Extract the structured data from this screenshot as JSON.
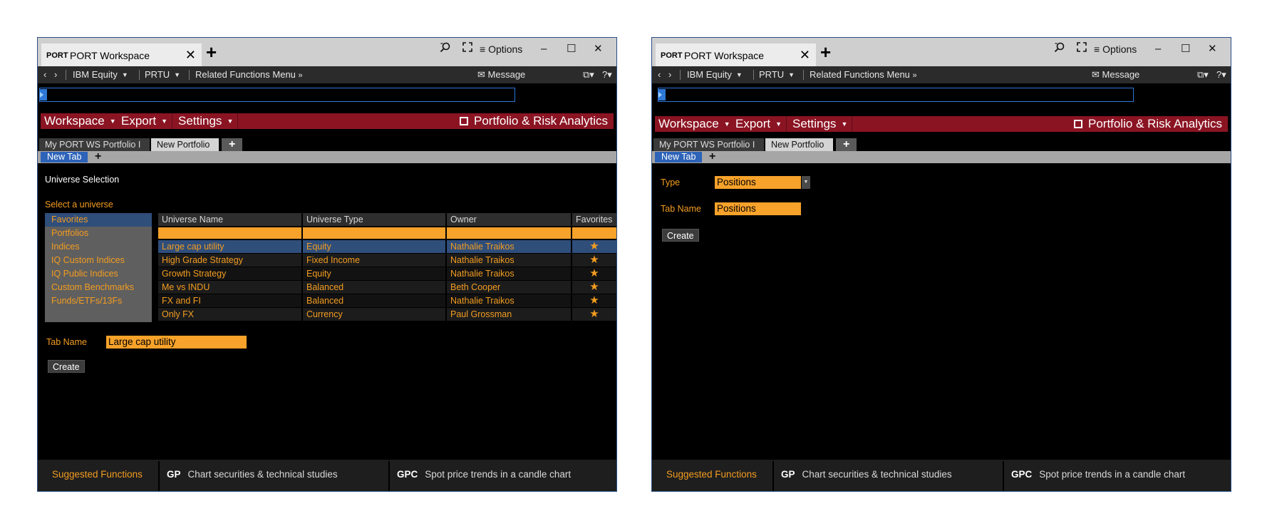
{
  "windows": [
    {
      "tab_prefix": "PORT",
      "tab_title": "PORT Workspace",
      "options_label": "Options",
      "nav": {
        "security": "IBM Equity",
        "function": "PRTU",
        "related": "Related Functions Menu",
        "message": "Message"
      },
      "menus": [
        "Workspace",
        "Export",
        "Settings"
      ],
      "app_title": "Portfolio & Risk Analytics",
      "portfolio_tabs": [
        "My PORT WS Portfolio I",
        "New Portfolio"
      ],
      "inner_tab": "New Tab",
      "heading": "Universe Selection",
      "select_label": "Select a universe",
      "universe_categories": [
        "Favorites",
        "Portfolios",
        "Indices",
        "IQ Custom Indices",
        "IQ Public Indices",
        "Custom Benchmarks",
        "Funds/ETFs/13Fs"
      ],
      "grid": {
        "headers": [
          "Universe Name",
          "Universe Type",
          "Owner",
          "Favorites"
        ],
        "rows": [
          {
            "name": "Large cap utility",
            "type": "Equity",
            "owner": "Nathalie Traikos"
          },
          {
            "name": "High Grade Strategy",
            "type": "Fixed Income",
            "owner": "Nathalie Traikos"
          },
          {
            "name": "Growth Strategy",
            "type": "Equity",
            "owner": "Nathalie Traikos"
          },
          {
            "name": "Me vs INDU",
            "type": "Balanced",
            "owner": "Beth Cooper"
          },
          {
            "name": "FX and FI",
            "type": "Balanced",
            "owner": "Nathalie Traikos"
          },
          {
            "name": "Only FX",
            "type": "Currency",
            "owner": "Paul Grossman"
          }
        ]
      },
      "tab_name_label": "Tab Name",
      "tab_name_value": "Large cap utility",
      "create_label": "Create",
      "footer": {
        "suggested": "Suggested Functions",
        "items": [
          {
            "code": "GP",
            "desc": "Chart securities & technical studies"
          },
          {
            "code": "GPC",
            "desc": "Spot price trends in a candle chart"
          }
        ]
      }
    },
    {
      "tab_prefix": "PORT",
      "tab_title": "PORT Workspace",
      "options_label": "Options",
      "nav": {
        "security": "IBM Equity",
        "function": "PRTU",
        "related": "Related Functions Menu",
        "message": "Message"
      },
      "menus": [
        "Workspace",
        "Export",
        "Settings"
      ],
      "app_title": "Portfolio & Risk Analytics",
      "portfolio_tabs": [
        "My PORT WS Portfolio I",
        "New Portfolio"
      ],
      "inner_tab": "New Tab",
      "type_label": "Type",
      "type_value": "Positions",
      "tab_name_label": "Tab Name",
      "tab_name_value": "Positions",
      "create_label": "Create",
      "footer": {
        "suggested": "Suggested Functions",
        "items": [
          {
            "code": "GP",
            "desc": "Chart securities & technical studies"
          },
          {
            "code": "GPC",
            "desc": "Spot price trends in a candle chart"
          }
        ]
      }
    }
  ],
  "colors": {
    "accent_orange": "#f39c20",
    "menu_red": "#8b1423",
    "select_blue": "#2f4e7a",
    "tab_blue": "#2d63b8"
  },
  "icons": [
    "search-icon",
    "expand-icon",
    "menu-icon",
    "minimize-icon",
    "maximize-icon",
    "close-icon",
    "mail-icon",
    "star-icon",
    "external-link-icon"
  ]
}
